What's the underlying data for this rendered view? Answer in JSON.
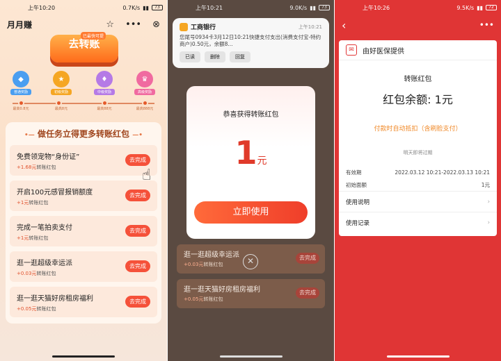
{
  "status": {
    "p1": {
      "time": "上午10:20",
      "speed": "0.7K/s",
      "battery": "73"
    },
    "p2": {
      "time": "上午10:21",
      "speed": "9.0K/s",
      "battery": "73"
    },
    "p3": {
      "time": "上午10:26",
      "speed": "9.5K/s",
      "battery": "72"
    }
  },
  "p1": {
    "title": "月月赚",
    "banner_button": "去转账",
    "banner_tag": "已最快可提",
    "levels": [
      {
        "name": "普通奖励",
        "amount": "最高0.8元",
        "color": "#4a9ef0"
      },
      {
        "name": "初级奖励",
        "amount": "最高8元",
        "color": "#f5a623"
      },
      {
        "name": "中级奖励",
        "amount": "最高88元",
        "color": "#b57ae6"
      },
      {
        "name": "高级奖励",
        "amount": "最高888元",
        "color": "#f06aa0"
      }
    ],
    "tasks_title": "做任务立得更多转账红包",
    "tasks": [
      {
        "name": "免费领宠物“身份证”",
        "reward": "+1.68元",
        "unit": "转账红包",
        "action": "去完成"
      },
      {
        "name": "开启100元感冒报销额度",
        "reward": "+1元",
        "unit": "转账红包",
        "action": "去完成"
      },
      {
        "name": "完成一笔拍卖支付",
        "reward": "+1元",
        "unit": "转账红包",
        "action": "去完成"
      },
      {
        "name": "逛一逛超级幸运派",
        "reward": "+0.03元",
        "unit": "转账红包",
        "action": "去完成"
      },
      {
        "name": "逛一逛天猫好房租房福利",
        "reward": "+0.05元",
        "unit": "转账红包",
        "action": "去完成"
      }
    ]
  },
  "p2": {
    "notif_bank": "工商银行",
    "notif_time": "上午10:21",
    "notif_body": "您尾号0934卡3月12日10:21快捷支付支出(消费支付宝-特约商户)0.50元，余额8...",
    "notif_actions": [
      "已读",
      "删除",
      "回复"
    ],
    "congrats": "恭喜获得转账红包",
    "amount": "1",
    "amount_unit": "元",
    "use_button": "立即使用",
    "tasks": [
      {
        "name": "逛一逛超级幸运派",
        "reward": "+0.03元",
        "unit": "转账红包",
        "action": "去完成"
      },
      {
        "name": "逛一逛天猫好房租房福利",
        "reward": "+0.05元",
        "unit": "转账红包",
        "action": "去完成"
      }
    ]
  },
  "p3": {
    "provider": "由好医保提供",
    "card_title": "转账红包",
    "balance": "红包余额: 1元",
    "auto_note": "付款时自动抵扣（含刷脸支付）",
    "expire_note": "明天即将过期",
    "validity_label": "有效期",
    "validity_value": "2022.03.12 10:21-2022.03.13 10:21",
    "face_label": "初始面额",
    "face_value": "1元",
    "links": [
      "使用说明",
      "使用记录"
    ]
  }
}
